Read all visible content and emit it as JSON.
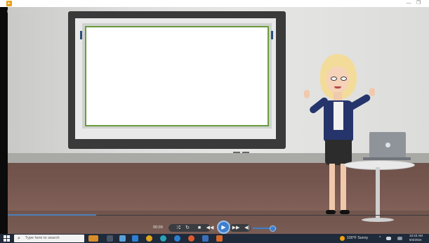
{
  "window": {
    "file_label": "LD 2-770s-239803",
    "minimize_glyph": "—",
    "restore_glyph": "❐"
  },
  "player": {
    "elapsed": "00:09",
    "buttons": {
      "shuffle": "⤮",
      "repeat": "↻",
      "stop": "■",
      "previous": "◀◀",
      "play": "▶",
      "next": "▶▶",
      "volume": "◀)"
    },
    "progress_fraction": 0.21,
    "volume_fraction": 0.7
  },
  "taskbar": {
    "search_placeholder": "Type here to search",
    "weather": "100°F  Sunny",
    "clock_time": "10:43 AM",
    "clock_date": "9/4/2024",
    "tray_up": "^"
  },
  "colors": {
    "accent": "#3f7fcc",
    "screen_border": "#6b9a3f",
    "taskbar": "#1f2a3a"
  }
}
